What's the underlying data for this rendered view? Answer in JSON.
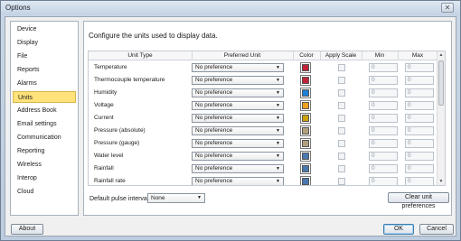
{
  "window": {
    "title": "Options",
    "close_glyph": "✕"
  },
  "sidebar": {
    "items": [
      {
        "label": "Device"
      },
      {
        "label": "Display"
      },
      {
        "label": "File"
      },
      {
        "label": "Reports"
      },
      {
        "label": "Alarms"
      },
      {
        "label": "Units",
        "selected": true
      },
      {
        "label": "Address Book"
      },
      {
        "label": "Email settings"
      },
      {
        "label": "Communication"
      },
      {
        "label": "Reporting"
      },
      {
        "label": "Wireless"
      },
      {
        "label": "Interop"
      },
      {
        "label": "Cloud"
      }
    ]
  },
  "panel": {
    "heading": "Configure the units used to display data.",
    "columns": {
      "unit_type": "Unit Type",
      "preferred_unit": "Preferred Unit",
      "color": "Color",
      "apply_scale": "Apply Scale",
      "min": "Min",
      "max": "Max"
    },
    "rows": [
      {
        "name": "Temperature",
        "unit": "No preference",
        "color": "#c0233a",
        "min": "0",
        "max": "0"
      },
      {
        "name": "Thermocouple temperature",
        "unit": "No preference",
        "color": "#c0233a",
        "min": "0",
        "max": "0"
      },
      {
        "name": "Humidity",
        "unit": "No preference",
        "color": "#1f7fd4",
        "min": "0",
        "max": "0"
      },
      {
        "name": "Voltage",
        "unit": "No preference",
        "color": "#f0a020",
        "min": "0",
        "max": "0"
      },
      {
        "name": "Current",
        "unit": "No preference",
        "color": "#c9a20c",
        "min": "0",
        "max": "0"
      },
      {
        "name": "Pressure (absolute)",
        "unit": "No preference",
        "color": "#b3a07e",
        "min": "0",
        "max": "0"
      },
      {
        "name": "Pressure (gauge)",
        "unit": "No preference",
        "color": "#b3a07e",
        "min": "0",
        "max": "0"
      },
      {
        "name": "Water level",
        "unit": "No preference",
        "color": "#4a78b0",
        "min": "0",
        "max": "0"
      },
      {
        "name": "Rainfall",
        "unit": "No preference",
        "color": "#4a78b0",
        "min": "0",
        "max": "0"
      },
      {
        "name": "Rainfall rate",
        "unit": "No preference",
        "color": "#4a78b0",
        "min": "0",
        "max": "0"
      }
    ],
    "dropdown_arrow": "▼",
    "scroll_up": "▲",
    "scroll_down": "▼",
    "pulse_label": "Default pulse interval:",
    "pulse_value": "None",
    "clear_button": "Clear unit preferences"
  },
  "footer": {
    "about": "About",
    "ok": "OK",
    "cancel": "Cancel"
  }
}
